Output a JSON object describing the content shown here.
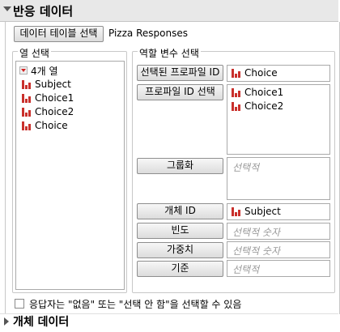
{
  "header": {
    "title": "반응 데이터"
  },
  "data_table": {
    "button_label": "데이터 테이블 선택",
    "table_name": "Pizza Responses"
  },
  "columns_panel": {
    "title": "열 선택",
    "count_label": "4개 열",
    "items": [
      {
        "label": "Subject",
        "icon": "nominal-bar-icon"
      },
      {
        "label": "Choice1",
        "icon": "nominal-bar-icon"
      },
      {
        "label": "Choice2",
        "icon": "nominal-bar-icon"
      },
      {
        "label": "Choice",
        "icon": "nominal-bar-icon"
      }
    ]
  },
  "roles_panel": {
    "title": "역할 변수 선택",
    "roles": {
      "selected_profile_id": {
        "label": "선택된 프로파일 ID",
        "values": [
          "Choice"
        ]
      },
      "profile_id_choices": {
        "label": "프로파일 ID 선택",
        "values": [
          "Choice1",
          "Choice2"
        ]
      },
      "grouping": {
        "label": "그룹화",
        "placeholder": "선택적"
      },
      "subject_id": {
        "label": "개체 ID",
        "values": [
          "Subject"
        ]
      },
      "frequency": {
        "label": "빈도",
        "placeholder": "선택적 숫자"
      },
      "weight": {
        "label": "가중치",
        "placeholder": "선택적 숫자"
      },
      "criterion": {
        "label": "기준",
        "placeholder": "선택적"
      }
    }
  },
  "option": {
    "label": "응답자는 \"없음\" 또는 \"선택 안 함\"을 선택할 수 있음",
    "checked": false
  },
  "footer": {
    "title": "개체 데이터"
  },
  "colors": {
    "header_bg": "#e8e8e8",
    "nominal_icon": "#c9302c"
  }
}
